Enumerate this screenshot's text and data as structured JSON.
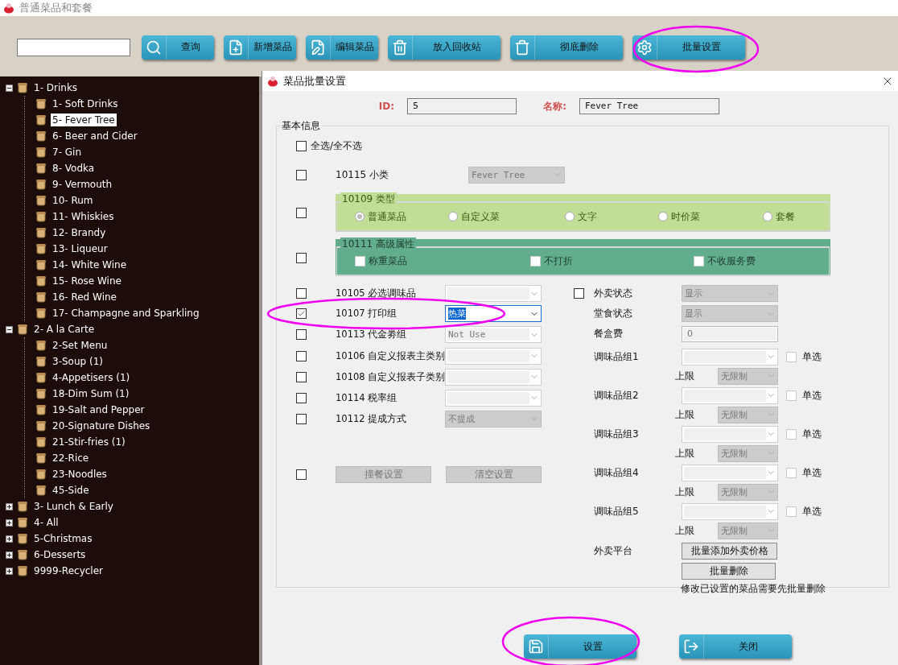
{
  "app_window": {
    "title": "普通菜品和套餐"
  },
  "toolbar": {
    "buttons": [
      {
        "label": "查询",
        "kind": "search",
        "highlighted": false
      },
      {
        "label": "新增菜品",
        "kind": "add",
        "highlighted": false
      },
      {
        "label": "编辑菜品",
        "kind": "edit",
        "highlighted": false
      },
      {
        "label": "放入回收站",
        "kind": "recycle",
        "highlighted": false
      },
      {
        "label": "彻底删除",
        "kind": "delete",
        "highlighted": false
      },
      {
        "label": "批量设置",
        "kind": "batch",
        "highlighted": true
      }
    ]
  },
  "tree": [
    {
      "label": "1- Drinks",
      "expanded": true,
      "children": [
        {
          "label": "1- Soft Drinks",
          "selected": false
        },
        {
          "label": "5- Fever Tree",
          "selected": true
        },
        {
          "label": "6- Beer and Cider",
          "selected": false
        },
        {
          "label": "7- Gin",
          "selected": false
        },
        {
          "label": "8- Vodka",
          "selected": false
        },
        {
          "label": "9- Vermouth",
          "selected": false
        },
        {
          "label": "10- Rum",
          "selected": false
        },
        {
          "label": "11- Whiskies",
          "selected": false
        },
        {
          "label": "12- Brandy",
          "selected": false
        },
        {
          "label": "13- Liqueur",
          "selected": false
        },
        {
          "label": "14- White Wine",
          "selected": false
        },
        {
          "label": "15- Rose Wine",
          "selected": false
        },
        {
          "label": "16- Red Wine",
          "selected": false
        },
        {
          "label": "17- Champagne and Sparkling",
          "selected": false
        }
      ]
    },
    {
      "label": "2- A la Carte",
      "expanded": true,
      "children": [
        {
          "label": "2-Set Menu",
          "selected": false
        },
        {
          "label": "3-Soup (1)",
          "selected": false
        },
        {
          "label": "4-Appetisers (1)",
          "selected": false
        },
        {
          "label": "18-Dim Sum (1)",
          "selected": false
        },
        {
          "label": "19-Salt and Pepper",
          "selected": false
        },
        {
          "label": "20-Signature Dishes",
          "selected": false
        },
        {
          "label": "21-Stir-fries (1)",
          "selected": false
        },
        {
          "label": "22-Rice",
          "selected": false
        },
        {
          "label": "23-Noodles",
          "selected": false
        },
        {
          "label": "45-Side",
          "selected": false
        }
      ]
    },
    {
      "label": "3- Lunch & Early",
      "expanded": false
    },
    {
      "label": "4- All",
      "expanded": false
    },
    {
      "label": "5-Christmas",
      "expanded": false
    },
    {
      "label": "6-Desserts",
      "expanded": false
    },
    {
      "label": "9999-Recycler",
      "expanded": false
    }
  ],
  "dialog": {
    "title": "菜品批量设置",
    "id_label": "ID:",
    "id_value": "5",
    "name_label": "名称:",
    "name_value": "Fever Tree",
    "section_title": "基本信息",
    "select_all": {
      "label": "全选/全不选",
      "checked": false
    },
    "subcategory": {
      "checked": false,
      "label": "10115 小类",
      "value": "Fever Tree",
      "disabled": true
    },
    "type_group": {
      "checked": false,
      "title": "10109 类型",
      "options": [
        {
          "label": "普通菜品",
          "selected": true
        },
        {
          "label": "自定义菜",
          "selected": false
        },
        {
          "label": "文字",
          "selected": false
        },
        {
          "label": "时价菜",
          "selected": false
        },
        {
          "label": "套餐",
          "selected": false
        }
      ]
    },
    "advanced_group": {
      "checked": false,
      "title": "10111 高级属性",
      "options": [
        {
          "label": "称重菜品",
          "checked": false
        },
        {
          "label": "不打折",
          "checked": false
        },
        {
          "label": "不收服务费",
          "checked": false
        }
      ]
    },
    "fields": [
      {
        "checked": false,
        "label": "10105 必选调味品",
        "disabled": false,
        "focused": false,
        "highlighted": false
      },
      {
        "checked": true,
        "label": "10107 打印组",
        "value": "热菜",
        "disabled": false,
        "focused": true,
        "highlighted": true
      },
      {
        "checked": false,
        "label": "10113 代金劵组",
        "value": "Not Use",
        "disabled": false,
        "focused": false,
        "highlighted": false
      },
      {
        "checked": false,
        "label": "10106 自定义报表主类别",
        "disabled": false,
        "focused": false,
        "highlighted": false
      },
      {
        "checked": false,
        "label": "10108 自定义报表子类别",
        "disabled": false,
        "focused": false,
        "highlighted": false
      },
      {
        "checked": false,
        "label": "10114 税率组",
        "disabled": false,
        "focused": false,
        "highlighted": false
      },
      {
        "checked": false,
        "label": "10112 提成方式",
        "value": "不提成",
        "disabled": true,
        "focused": false,
        "highlighted": false
      }
    ],
    "combo": {
      "checked": false,
      "buttons": [
        "撞餐设置",
        "清空设置"
      ]
    },
    "status_fields": [
      {
        "kind": "select",
        "checked": false,
        "label": "外卖状态",
        "value": "显示"
      },
      {
        "kind": "select",
        "label": "堂食状态",
        "value": "显示"
      },
      {
        "kind": "text",
        "label": "餐盒费",
        "value": "0"
      }
    ],
    "condiment_groups": [
      {
        "label": "调味品组1",
        "single_label": "单选",
        "single": false,
        "limit_label": "上限",
        "limit": "无限制"
      },
      {
        "label": "调味品组2",
        "single_label": "单选",
        "single": false,
        "limit_label": "上限",
        "limit": "无限制"
      },
      {
        "label": "调味品组3",
        "single_label": "单选",
        "single": false,
        "limit_label": "上限",
        "limit": "无限制"
      },
      {
        "label": "调味品组4",
        "single_label": "单选",
        "single": false,
        "limit_label": "上限",
        "limit": "无限制"
      },
      {
        "label": "调味品组5",
        "single_label": "单选",
        "single": false,
        "limit_label": "上限",
        "limit": "无限制"
      }
    ],
    "takeaway": {
      "label": "外卖平台",
      "add_button": "批量添加外卖价格",
      "delete_button": "批量删除",
      "note": "修改已设置的菜品需要先批量删除"
    },
    "footer_buttons": [
      {
        "label": "设置",
        "kind": "save",
        "highlighted": true
      },
      {
        "label": "关闭",
        "kind": "exit",
        "highlighted": false
      }
    ]
  }
}
